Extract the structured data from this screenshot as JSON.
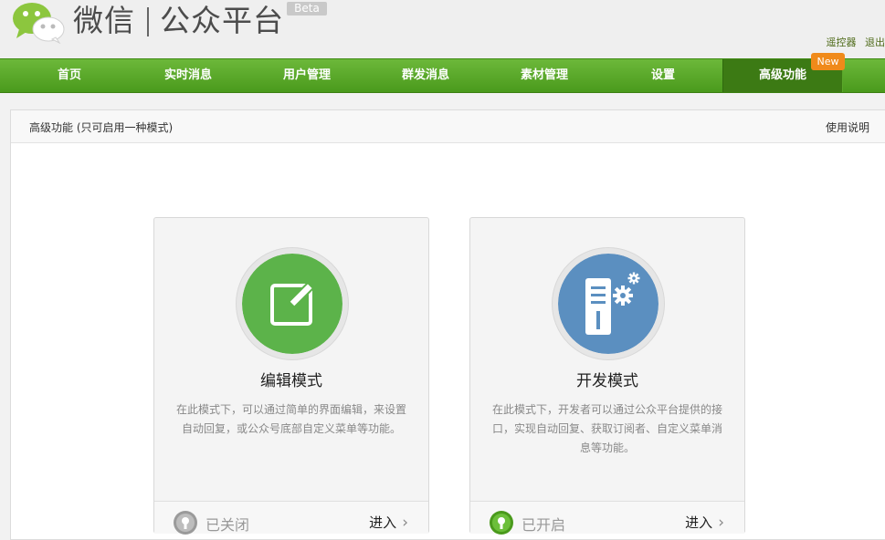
{
  "header": {
    "brand_name": "微信",
    "brand_sub": "公众平台",
    "beta_label": "Beta",
    "links": [
      "遥控器",
      "退出"
    ]
  },
  "nav": {
    "items": [
      "首页",
      "实时消息",
      "用户管理",
      "群发消息",
      "素材管理",
      "设置",
      "高级功能"
    ],
    "active_index": 6,
    "new_badge": "New"
  },
  "panel": {
    "title": "高级功能 (只可启用一种模式)",
    "help_link": "使用说明"
  },
  "cards": [
    {
      "title": "编辑模式",
      "description": "在此模式下，可以通过简单的界面编辑，来设置自动回复，或公众号底部自定义菜单等功能。",
      "status": "已关闭",
      "status_state": "off",
      "enter_label": "进入",
      "icon": "edit-icon",
      "icon_color": "#5cb34a"
    },
    {
      "title": "开发模式",
      "description": "在此模式下，开发者可以通过公众平台提供的接口，实现自动回复、获取订阅者、自定义菜单消息等功能。",
      "status": "已开启",
      "status_state": "on",
      "enter_label": "进入",
      "icon": "server-gear-icon",
      "icon_color": "#5b8fc0"
    }
  ],
  "colors": {
    "nav_green": "#5aa82a",
    "badge_orange": "#f08a1a"
  }
}
